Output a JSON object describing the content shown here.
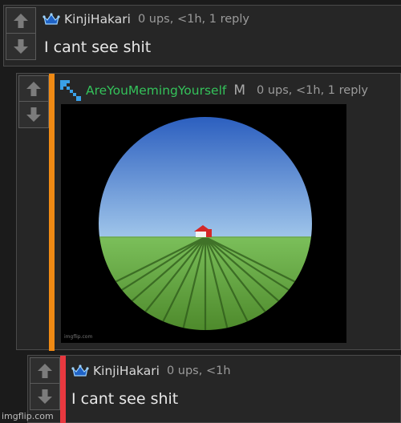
{
  "comments": [
    {
      "username": "KinjiHakari",
      "meta": "0 ups, <1h, 1 reply",
      "text": "I cant see shit",
      "icon": "crown-icon"
    },
    {
      "username": "AreYouMemingYourself",
      "mod_badge": "M",
      "meta": "0 ups, <1h, 1 reply",
      "icon": "pixel-arrow-icon",
      "image_credit": "imgflip.com",
      "accent_color": "#f08a14"
    },
    {
      "username": "KinjiHakari",
      "meta": "0 ups, <1h",
      "text": "I cant see shit",
      "icon": "crown-icon",
      "accent_color": "#e8383f"
    }
  ],
  "watermark": "imgflip.com",
  "colors": {
    "upvote": "#7c7c7c",
    "username_green": "#34c25a"
  }
}
